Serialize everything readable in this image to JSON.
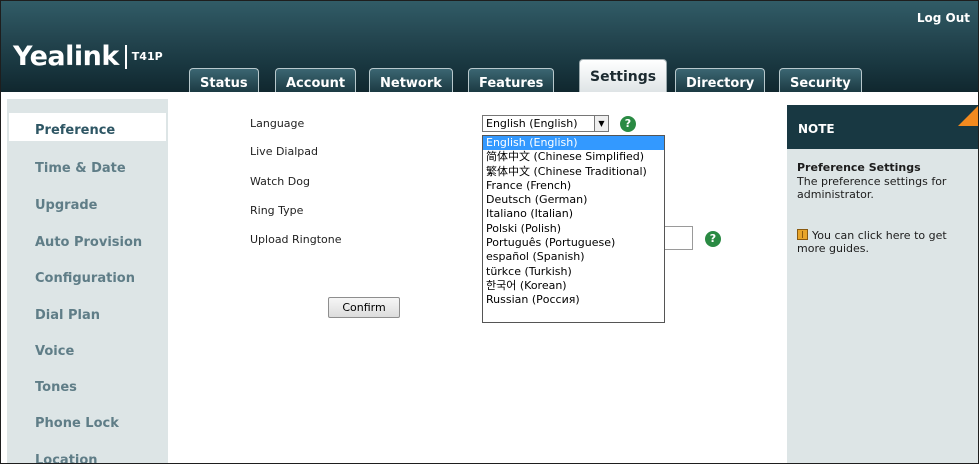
{
  "brand": {
    "logo": "Yealink",
    "model": "T41P"
  },
  "header": {
    "logout": "Log Out"
  },
  "tabs": [
    {
      "label": "Status"
    },
    {
      "label": "Account"
    },
    {
      "label": "Network"
    },
    {
      "label": "Features"
    },
    {
      "label": "Settings",
      "active": true
    },
    {
      "label": "Directory"
    },
    {
      "label": "Security"
    }
  ],
  "sidebar": {
    "items": [
      {
        "label": "Preference",
        "active": true
      },
      {
        "label": "Time & Date"
      },
      {
        "label": "Upgrade"
      },
      {
        "label": "Auto Provision"
      },
      {
        "label": "Configuration"
      },
      {
        "label": "Dial Plan"
      },
      {
        "label": "Voice"
      },
      {
        "label": "Tones"
      },
      {
        "label": "Phone Lock"
      },
      {
        "label": "Location"
      }
    ]
  },
  "form": {
    "language_label": "Language",
    "live_dialpad_label": "Live Dialpad",
    "watch_dog_label": "Watch Dog",
    "ring_type_label": "Ring Type",
    "upload_ringtone_label": "Upload Ringtone",
    "language_value": "English (English)",
    "confirm": "Confirm",
    "help_glyph": "?"
  },
  "language_options": [
    "English (English)",
    "简体中文 (Chinese Simplified)",
    "繁体中文 (Chinese Traditional)",
    "France (French)",
    "Deutsch (German)",
    "Italiano (Italian)",
    "Polski (Polish)",
    "Português (Portuguese)",
    "español (Spanish)",
    "türkce (Turkish)",
    "한국어 (Korean)",
    "Russian (Россия)"
  ],
  "note": {
    "title": "NOTE",
    "subtitle": "Preference Settings",
    "body": "The preference settings for administrator.",
    "guide": "You can click here to get more guides."
  },
  "colors": {
    "header_dark": "#183842",
    "accent_orange": "#f28a1f",
    "sidebar_bg": "#dde5e6",
    "selected_option": "#3399ff",
    "help_green": "#2a8a43"
  }
}
